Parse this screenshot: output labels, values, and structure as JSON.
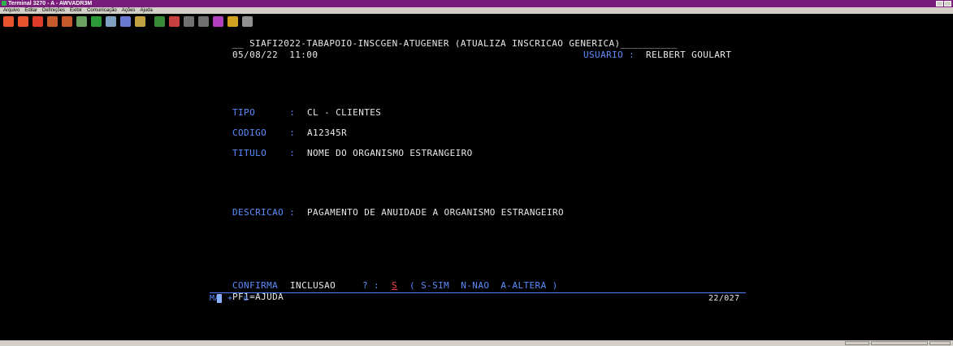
{
  "window": {
    "title": "Terminal 3270 - A - AWVADR3M"
  },
  "menu": [
    "Arquivo",
    "Editar",
    "Definições",
    "Exibir",
    "Comunicação",
    "Ações",
    "Ajuda"
  ],
  "toolbar_icons": [
    "connect-icon",
    "disconnect-icon",
    "exit-icon",
    "send-icon",
    "receive-icon",
    "copy-icon",
    "paste-icon",
    "macro-icon",
    "keyboard-icon",
    "print-icon",
    "record-icon",
    "stop-icon",
    "upload-icon",
    "download-icon",
    "link-icon",
    "transfer-icon",
    "refresh-icon"
  ],
  "terminal": {
    "header": "__ SIAFI2022-TABAPOIO-INSCGEN-ATUGENER (ATUALIZA INSCRICAO GENERICA)__________",
    "date_time": "05/08/22  11:00",
    "user_label": "USUARIO : ",
    "user_value": "RELBERT GOULART",
    "tipo_label": "TIPO      : ",
    "tipo_value": "CL - CLIENTES",
    "codigo_label": "CODIGO    : ",
    "codigo_value": "A12345R",
    "titulo_label": "TITULO    : ",
    "titulo_value": "NOME DO ORGANISMO ESTRANGEIRO",
    "descricao_label": "DESCRICAO : ",
    "descricao_value": "PAGAMENTO DE ANUIDADE A ORGANISMO ESTRANGEIRO",
    "confirma_label": "CONFIRMA",
    "confirma_label2": " INCLUSAO  ",
    "confirma_prompt": "? : ",
    "confirma_value": "S",
    "confirma_options": "  ( S-SIM  N-NAO  A-ALTERA )",
    "pf1": "PF1=AJUDA",
    "oia_left": "MA",
    "oia_mid": "+  a",
    "oia_position": "22/027"
  }
}
